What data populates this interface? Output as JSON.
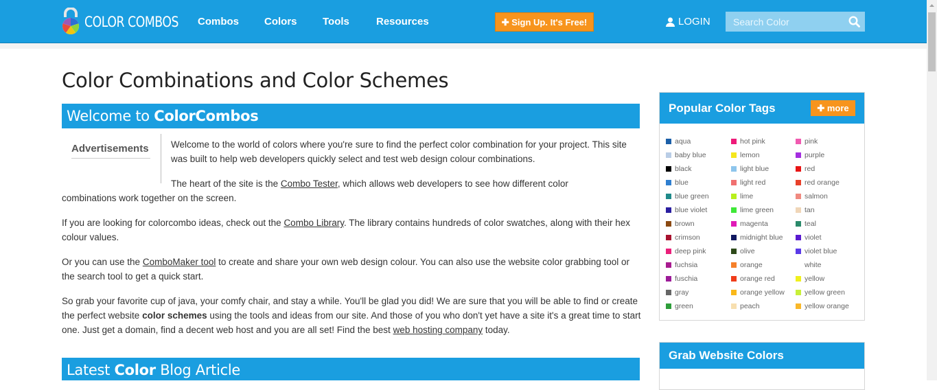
{
  "header": {
    "logo_text": "COLOR COMBOS",
    "nav": [
      "Combos",
      "Colors",
      "Tools",
      "Resources"
    ],
    "signup_label": "Sign Up. It's Free!",
    "login_label": "LOGIN",
    "search_placeholder": "Search Color"
  },
  "main": {
    "page_title": "Color Combinations and Color Schemes",
    "welcome_prefix": "Welcome to ",
    "welcome_brand": "ColorCombos",
    "ads_label": "Advertisements",
    "p1": "Welcome to the world of colors where you're sure to find the perfect color combination for your project. This site was built to help web developers quickly select and test web design colour combinations.",
    "p2_a": "The heart of the site is the ",
    "p2_link": "Combo Tester",
    "p2_b": ", which allows web developers to see how different color",
    "p2_c": "combinations work together on the screen.",
    "p3_a": "If you are looking for colorcombo ideas, check out the ",
    "p3_link": "Combo Library",
    "p3_b": ". The library contains hundreds of color swatches, along with their hex colour values.",
    "p4_a": "Or you can use the ",
    "p4_link": "ComboMaker tool",
    "p4_b": " to create and share your own web design colour. You can also use the website color grabbing tool or the search tool to get a quick start.",
    "p5_a": "So grab your favorite cup of java, your comfy chair, and stay a while. You'll be glad you did! We are sure that you will be able to find or create the perfect website ",
    "p5_bold": "color schemes",
    "p5_b": " using the tools and ideas from our site. And those of you who don't yet have a site it's a great time to start one. Just get a domain, find a decent web host and you are all set! Find the best ",
    "p5_link": "web hosting company",
    "p5_c": " today.",
    "blog_prefix": "Latest ",
    "blog_bold": "Color",
    "blog_suffix": " Blog Article"
  },
  "sidebar": {
    "tags_title": "Popular Color Tags",
    "more_label": "more",
    "grab_title": "Grab Website Colors",
    "tags": [
      [
        {
          "label": "aqua",
          "color": "#1b5fa8"
        },
        {
          "label": "baby blue",
          "color": "#b9cde6"
        },
        {
          "label": "black",
          "color": "#000000"
        },
        {
          "label": "blue",
          "color": "#2f7fd0"
        },
        {
          "label": "blue green",
          "color": "#1f8a8a"
        },
        {
          "label": "blue violet",
          "color": "#2a1ea0"
        },
        {
          "label": "brown",
          "color": "#8b4a12"
        },
        {
          "label": "crimson",
          "color": "#a8122f"
        },
        {
          "label": "deep pink",
          "color": "#ea1f7a"
        },
        {
          "label": "fuchsia",
          "color": "#a81b8f"
        },
        {
          "label": "fuschia",
          "color": "#9c1a98"
        },
        {
          "label": "gray",
          "color": "#666666"
        },
        {
          "label": "green",
          "color": "#2e9e3a"
        }
      ],
      [
        {
          "label": "hot pink",
          "color": "#ee1a79"
        },
        {
          "label": "lemon",
          "color": "#f5e61d"
        },
        {
          "label": "light blue",
          "color": "#8ec5ec"
        },
        {
          "label": "light red",
          "color": "#f07070"
        },
        {
          "label": "lime",
          "color": "#b8f01d"
        },
        {
          "label": "lime green",
          "color": "#3fe838"
        },
        {
          "label": "magenta",
          "color": "#e01ab7"
        },
        {
          "label": "midnight blue",
          "color": "#101860"
        },
        {
          "label": "olive",
          "color": "#2e4a1a"
        },
        {
          "label": "orange",
          "color": "#f5802a"
        },
        {
          "label": "orange red",
          "color": "#f03c1a"
        },
        {
          "label": "orange yellow",
          "color": "#f9b81a"
        },
        {
          "label": "peach",
          "color": "#f7dfb0"
        }
      ],
      [
        {
          "label": "pink",
          "color": "#f05ab0"
        },
        {
          "label": "purple",
          "color": "#a42ee0"
        },
        {
          "label": "red",
          "color": "#e81414"
        },
        {
          "label": "red orange",
          "color": "#e8402a"
        },
        {
          "label": "salmon",
          "color": "#f08a80"
        },
        {
          "label": "tan",
          "color": "#f0d6b8"
        },
        {
          "label": "teal",
          "color": "#2a8a6a"
        },
        {
          "label": "violet",
          "color": "#5a1ad0"
        },
        {
          "label": "violet blue",
          "color": "#5a3ae8"
        },
        {
          "label": "white",
          "color": "#ffffff"
        },
        {
          "label": "yellow",
          "color": "#f0f01d"
        },
        {
          "label": "yellow green",
          "color": "#c8f03a"
        },
        {
          "label": "yellow orange",
          "color": "#f9b82a"
        }
      ]
    ]
  },
  "colors": {
    "brand_blue": "#1a9ee0",
    "accent_orange": "#f7941d"
  }
}
